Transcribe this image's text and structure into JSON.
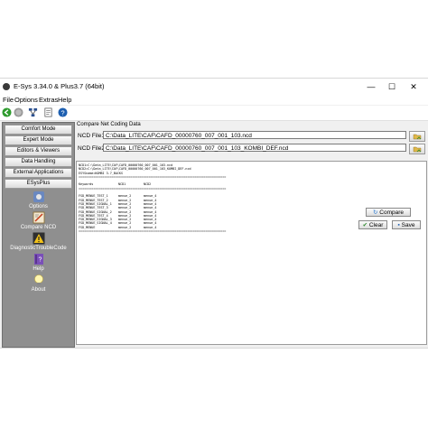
{
  "window": {
    "title": "E-Sys 3.34.0 & Plus3.7  (64bit)",
    "min_glyph": "—",
    "max_glyph": "☐",
    "close_glyph": "✕"
  },
  "menu": [
    "File",
    "Options",
    "Extras",
    "Help"
  ],
  "toolbar": {
    "icons": [
      "back-icon",
      "stop-icon",
      "network-icon",
      "document-icon",
      "help-icon"
    ],
    "colors": {
      "back": "#2e9b2e",
      "stop": "#9a9a9a",
      "help": "#1d5fb0"
    }
  },
  "sidebar": {
    "buttons": [
      "Comfort Mode",
      "Expert Mode",
      "Editors & Viewers",
      "Data Handling",
      "External Applications",
      "ESysPlus"
    ],
    "tools": [
      {
        "label": "Options",
        "icon": "options-icon"
      },
      {
        "label": "Compare NCD",
        "icon": "compare-ncd-icon"
      },
      {
        "label": "DiagnosticTroubleCode",
        "icon": "warning-icon"
      },
      {
        "label": "Help",
        "icon": "help-book-icon"
      },
      {
        "label": "About",
        "icon": "lightbulb-icon"
      }
    ]
  },
  "compare": {
    "group_label": "Compare Net Coding Data",
    "file1_label": "NCD File1:",
    "file1_value": "C:\\Data_LITE\\CAF\\CAFD_00000760_007_001_103.ncd",
    "file2_label": "NCD File2:",
    "file2_value": "C:\\Data_LITE\\CAF\\CAFD_00000760_007_001_103_KOMBI_DEF.ncd",
    "compare_button": "Compare",
    "clear_button": "Clear",
    "save_button": "Save"
  },
  "output": {
    "header_lines": [
      "NCD1=C:\\Data_LITE\\CAF\\CAFD_00000760_007_001_103.ncd",
      "NCD2=C:\\Data_LITE\\CAF\\CAFD_00000760_007_001_103_KOMBI_DEF.ncd",
      "ESYSname=KOMBI 3.7_BACKS"
    ],
    "separator": "================================================================================",
    "columns": [
      "Keywords",
      "NCD1",
      "NCD2"
    ],
    "rows": [
      [
        "FSD_MENUE_TEST_1",
        "menue_2",
        "menue_4"
      ],
      [
        "FSD_MENUE_TEST_2",
        "menue_2",
        "menue_4"
      ],
      [
        "FSD_MENUE_SIGNAL_1",
        "menue_2",
        "menue_4"
      ],
      [
        "FSD_MENUE_TEST_3",
        "menue_2",
        "menue_4"
      ],
      [
        "FSD_MENUE_SIGNAL_2",
        "menue_2",
        "menue_4"
      ],
      [
        "FSD_MENUE_TEST_4",
        "menue_2",
        "menue_4"
      ],
      [
        "FSD_MENUE_SIGNAL_3",
        "menue_2",
        "menue_4"
      ],
      [
        "FSD_MENUE_SIGNAL_4",
        "menue_2",
        "menue_4"
      ],
      [
        "FSD_MENUE",
        "menue_2",
        "menue_4"
      ]
    ]
  }
}
